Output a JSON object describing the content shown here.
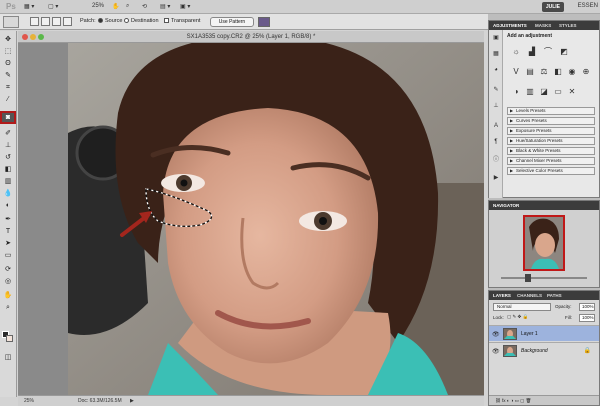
{
  "app": {
    "logo": "Ps",
    "zoom_menu": "25%",
    "workspace_user": "JULIE",
    "workspace_label": "ESSEN"
  },
  "options_bar": {
    "patch_label": "Patch:",
    "source_label": "Source",
    "destination_label": "Destination",
    "transparent_label": "Transparent",
    "use_pattern_label": "Use Pattern",
    "source_selected": true
  },
  "document": {
    "title": "SX1A3535 copy.CR2 @ 25% (Layer 1, RGB/8) *",
    "zoom": "25%",
    "doc_size": "Doc: 63.3M/126.5M",
    "selection": "patch-lasso-under-left-eye",
    "arrow_color": "#a3261d"
  },
  "adjustments": {
    "tabs": [
      "ADJUSTMENTS",
      "MASKS",
      "STYLES"
    ],
    "heading": "Add an adjustment",
    "presets": [
      "Levels Presets",
      "Curves Presets",
      "Exposure Presets",
      "Hue/Saturation Presets",
      "Black & White Presets",
      "Channel Mixer Presets",
      "Selective Color Presets"
    ]
  },
  "navigator": {
    "tab": "NAVIGATOR"
  },
  "layers": {
    "tabs": [
      "LAYERS",
      "CHANNELS",
      "PATHS"
    ],
    "blend_mode": "Normal",
    "opacity_label": "Opacity:",
    "opacity_value": "100%",
    "lock_label": "Lock:",
    "fill_label": "Fill:",
    "fill_value": "100%",
    "items": [
      {
        "name": "Layer 1",
        "selected": true
      },
      {
        "name": "Background",
        "selected": false,
        "locked": true
      }
    ]
  },
  "colors": {
    "accent_red": "#b11a1a",
    "layer_selected": "#9db3dd",
    "panel_header": "#3c3c3c"
  }
}
